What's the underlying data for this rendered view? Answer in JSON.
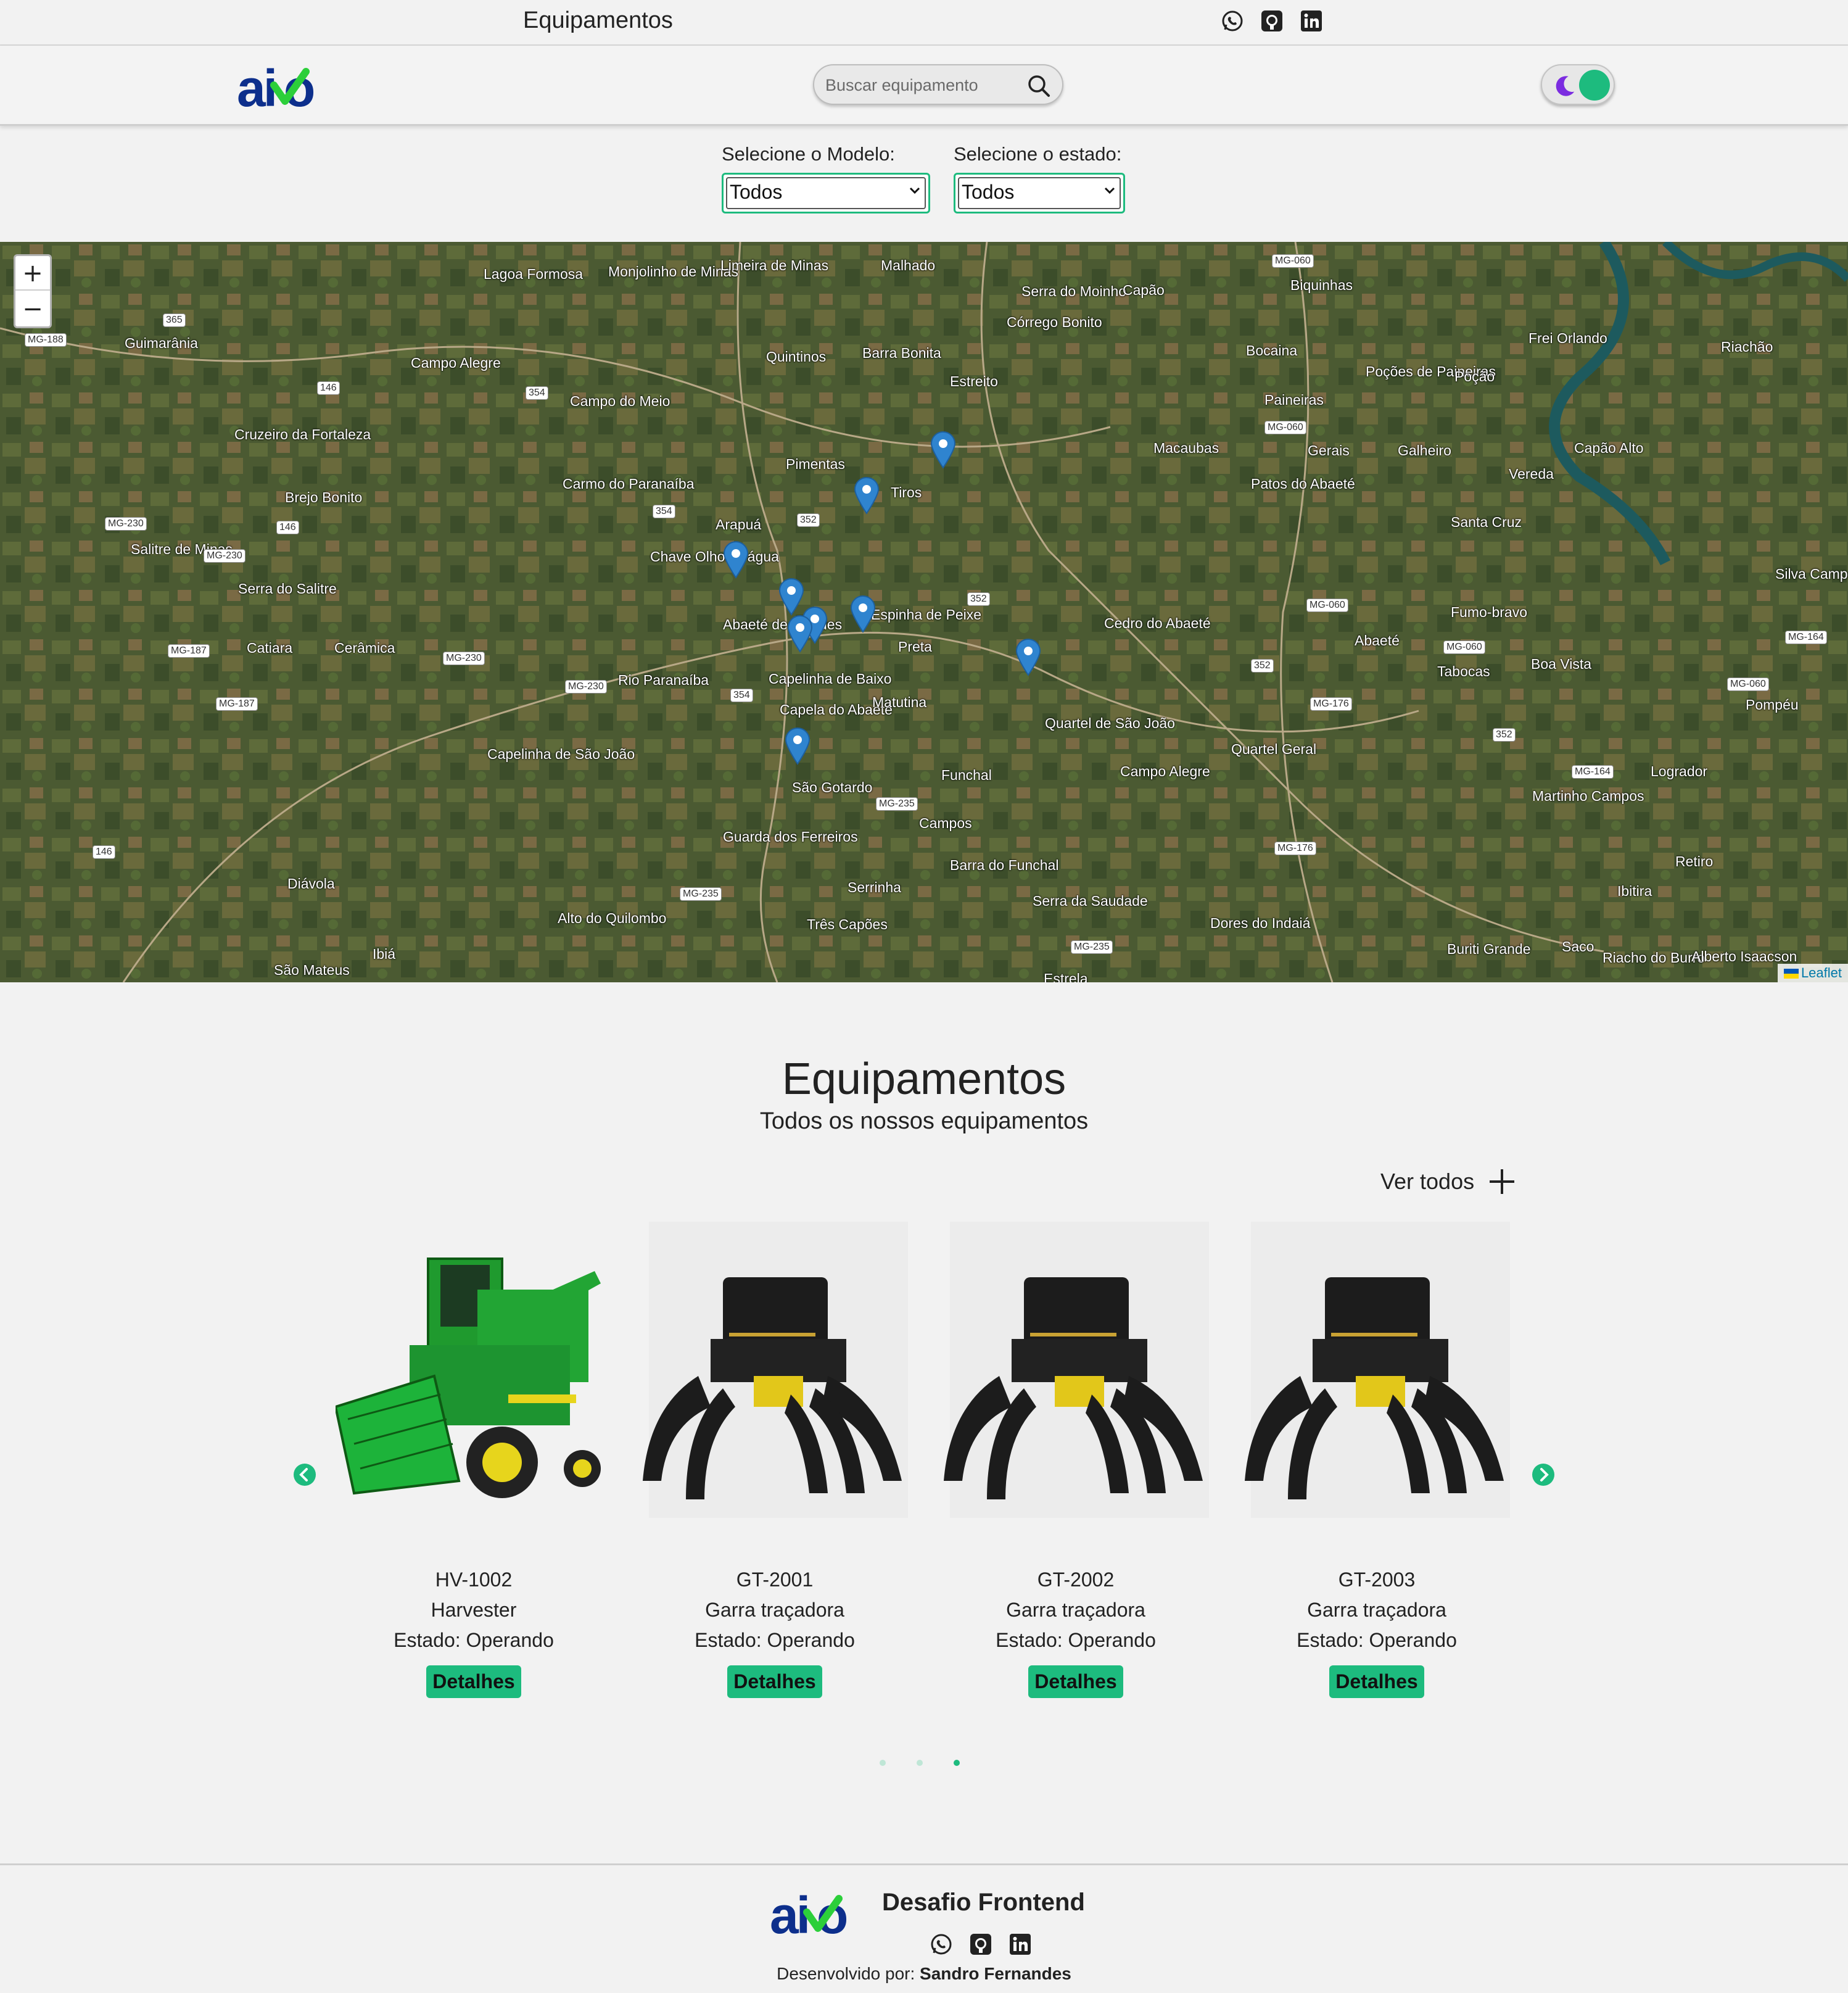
{
  "topbar": {
    "title": "Equipamentos",
    "socials": [
      "whatsapp-icon",
      "github-icon",
      "linkedin-icon"
    ]
  },
  "header": {
    "logo_text": "aiko",
    "search_placeholder": "Buscar equipamento",
    "theme_toggle": {
      "icon": "moon-icon",
      "state": "on"
    }
  },
  "filters": {
    "model_label": "Selecione o Modelo:",
    "model_value": "Todos",
    "state_label": "Selecione o estado:",
    "state_value": "Todos"
  },
  "map": {
    "zoom_in": "+",
    "zoom_out": "−",
    "attribution": "Leaflet",
    "places": [
      "Lagoa Formosa",
      "Monjolinho de Minas",
      "Limeira de Minas",
      "Malhado",
      "Serra do Moinho",
      "Córrego Bonito",
      "Capão",
      "Biquinhas",
      "Guimarânia",
      "Campo Alegre",
      "Quintinos",
      "Barra Bonita",
      "Estreito",
      "Bocaina",
      "Frei Orlando",
      "Riachão",
      "Poções de Paineiras",
      "Poção",
      "Campo do Meio",
      "Cruzeiro da Fortaleza",
      "Pimentas",
      "Macaubas",
      "Paineiras",
      "Gerais",
      "Galheiro",
      "Capão Alto",
      "Carmo do Paranaíba",
      "Brejo Bonito",
      "Tiros",
      "Patos do Abaeté",
      "Vereda",
      "Arapuá",
      "Santa Cruz",
      "Salitre de Minas",
      "Chave Olhos-d'água",
      "Serra do Salitre",
      "Silva Campos",
      "Abaeté de Mendes",
      "Espinha de Peixe",
      "Preta",
      "Cedro do Abaeté",
      "Fumo-bravo",
      "Catiara",
      "Cerâmica",
      "Abaeté",
      "Tabocas",
      "Boa Vista",
      "Rio Paranaíba",
      "Capelinha de Baixo",
      "Capela do Abaeté",
      "Matutina",
      "Quartel de São João",
      "Pompéu",
      "Quartel Geral",
      "Capelinha de São João",
      "São Gotardo",
      "Funchal",
      "Campo Alegre",
      "Logrador",
      "Martinho Campos",
      "Guarda dos Ferreiros",
      "Campos",
      "Diávola",
      "Barra do Funchal",
      "Serrinha",
      "Serra da Saudade",
      "Retiro",
      "Ibitira",
      "Alto do Quilombo",
      "Três Capões",
      "Dores do Indaiá",
      "Ibiá",
      "São Mateus",
      "Buriti Grande",
      "Saco",
      "Riacho do Burro",
      "Alberto Isaacson",
      "Estrela"
    ],
    "roads": [
      "MG-188",
      "365",
      "146",
      "354",
      "MG-060",
      "MG-230",
      "352",
      "MG-187",
      "MG-176",
      "MG-164",
      "MG-235"
    ],
    "markers": 10
  },
  "section": {
    "title": "Equipamentos",
    "subtitle": "Todos os nossos equipamentos",
    "view_all": "Ver todos"
  },
  "equipments": [
    {
      "code": "HV-1002",
      "model": "Harvester",
      "state": "Estado: Operando",
      "button": "Detalhes",
      "image": "harvester"
    },
    {
      "code": "GT-2001",
      "model": "Garra traçadora",
      "state": "Estado: Operando",
      "button": "Detalhes",
      "image": "grapple"
    },
    {
      "code": "GT-2002",
      "model": "Garra traçadora",
      "state": "Estado: Operando",
      "button": "Detalhes",
      "image": "grapple"
    },
    {
      "code": "GT-2003",
      "model": "Garra traçadora",
      "state": "Estado: Operando",
      "button": "Detalhes",
      "image": "grapple"
    }
  ],
  "pagination": {
    "pages": 3,
    "active": 3
  },
  "footer": {
    "title": "Desafio Frontend",
    "credit_prefix": "Desenvolvido por: ",
    "credit_name": "Sandro Fernandes"
  },
  "colors": {
    "accent": "#1dbb7e",
    "logo_blue": "#0d2f8c",
    "logo_green": "#2ccf3a",
    "toggle_moon": "#7b2ce0",
    "marker": "#2f84cf"
  }
}
